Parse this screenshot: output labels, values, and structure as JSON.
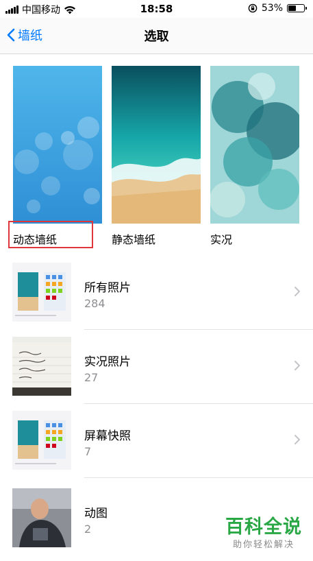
{
  "status_bar": {
    "carrier": "中国移动",
    "time": "18:58",
    "battery_percent": "53%",
    "battery_level": 0.53
  },
  "nav": {
    "back_label": "墙纸",
    "title": "选取"
  },
  "wallpaper_categories": [
    {
      "label": "动态墙纸"
    },
    {
      "label": "静态墙纸"
    },
    {
      "label": "实况"
    }
  ],
  "albums": [
    {
      "name": "所有照片",
      "count": "284"
    },
    {
      "name": "实况照片",
      "count": "27"
    },
    {
      "name": "屏幕快照",
      "count": "7"
    },
    {
      "name": "动图",
      "count": "2"
    }
  ],
  "watermark": {
    "main": "百科全说",
    "sub": "助你轻松解决"
  },
  "colors": {
    "accent": "#007aff",
    "highlight": "#e0353b",
    "watermark": "#2aa845"
  }
}
